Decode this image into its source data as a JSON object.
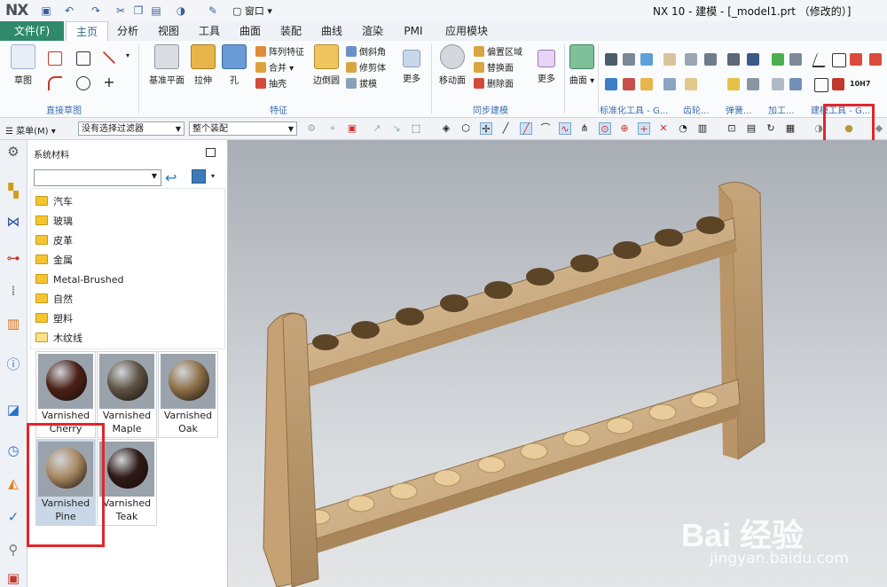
{
  "app": {
    "logo": "NX",
    "title": "NX 10 - 建模 - [_model1.prt （修改的）]",
    "window_menu": "窗口"
  },
  "menu_tabs": [
    {
      "label": "文件(F)"
    },
    {
      "label": "主页"
    },
    {
      "label": "分析"
    },
    {
      "label": "视图"
    },
    {
      "label": "工具"
    },
    {
      "label": "曲面"
    },
    {
      "label": "装配"
    },
    {
      "label": "曲线"
    },
    {
      "label": "渲染"
    },
    {
      "label": "PMI"
    },
    {
      "label": "应用模块"
    }
  ],
  "ribbon": {
    "sketch": "草图",
    "group_direct_sketch": "直接草图",
    "datum_plane": "基准平面",
    "extrude": "拉伸",
    "hole": "孔",
    "pattern_feature": "阵列特征",
    "unite": "合并",
    "shell": "抽壳",
    "edge_blend": "边倒圆",
    "chamfer": "倒斜角",
    "trim_body": "修剪体",
    "draft": "拔模",
    "more1": "更多",
    "group_feature": "特征",
    "move_face": "移动面",
    "offset_region": "偏置区域",
    "replace_face": "替换面",
    "delete_face": "删除面",
    "more2": "更多",
    "surface": "曲面",
    "group_sync": "同步建模",
    "group_std_tools": "标准化工具 - G...",
    "group_gear": "齿轮...",
    "group_spring": "弹簧...",
    "group_process": "加工...",
    "group_modeling_tools": "建模工具 - G...",
    "tolerance_label": "10H7"
  },
  "selection_bar": {
    "menu": "菜单(M)",
    "filter": "没有选择过滤器",
    "scope": "整个装配"
  },
  "panel": {
    "title": "系统材料",
    "folders": [
      "汽车",
      "玻璃",
      "皮革",
      "金属",
      "Metal-Brushed",
      "自然",
      "塑料",
      "木纹线"
    ],
    "materials": [
      {
        "line1": "Varnished",
        "line2": "Cherry",
        "color": "#4a2118"
      },
      {
        "line1": "Varnished",
        "line2": "Maple",
        "color": "#5d5444"
      },
      {
        "line1": "Varnished",
        "line2": "Oak",
        "color": "#8d7048"
      },
      {
        "line1": "Varnished",
        "line2": "Pine",
        "color": "#a78962"
      },
      {
        "line1": "Varnished",
        "line2": "Teak",
        "color": "#2f1a16"
      }
    ]
  },
  "watermark": {
    "brand": "Bai 经验",
    "url": "jingyan.baidu.com"
  },
  "colors": {
    "model": "#d2b28a",
    "highlight": "#e1262b",
    "file_tab": "#2e8a6a"
  }
}
